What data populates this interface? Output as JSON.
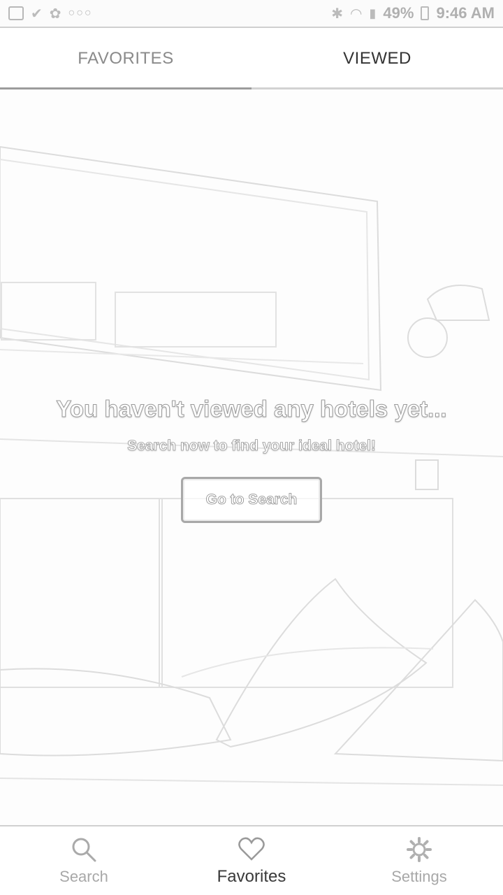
{
  "status_bar": {
    "battery": "49%",
    "time": "9:46 AM",
    "icons": [
      "gallery-icon",
      "check-icon",
      "fan-icon",
      "more-icon",
      "bluetooth-icon",
      "wifi-icon",
      "signal-icon",
      "battery-icon"
    ]
  },
  "tabs": [
    {
      "label": "FAVORITES",
      "active": false
    },
    {
      "label": "VIEWED",
      "active": true
    }
  ],
  "empty_state": {
    "title": "You haven't viewed any hotels yet...",
    "subtitle": "Search now to find your ideal hotel!",
    "button_label": "Go to Search"
  },
  "bottom_nav": [
    {
      "label": "Search",
      "icon": "search-icon",
      "active": false
    },
    {
      "label": "Favorites",
      "icon": "heart-icon",
      "active": true
    },
    {
      "label": "Settings",
      "icon": "gear-icon",
      "active": false
    }
  ],
  "colors": {
    "accent": "#333333",
    "muted": "#a8a8a8",
    "divider": "#d0d0d0"
  }
}
